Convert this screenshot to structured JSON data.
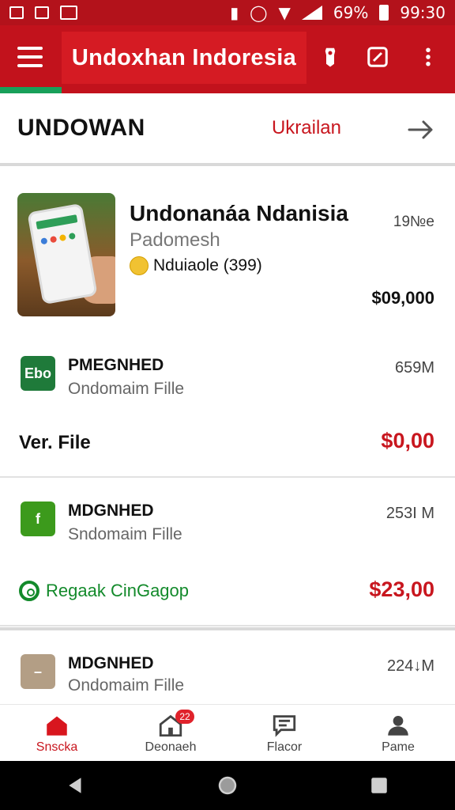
{
  "status_bar": {
    "battery": "69%",
    "time": "99:30"
  },
  "app_bar": {
    "title": "Undoxhan Indoresia"
  },
  "header": {
    "title": "UNDOWAN",
    "link": "Ukrailan"
  },
  "featured": {
    "title": "Undonanáa Ndanisia",
    "subtitle": "Padomesh",
    "rating": "Nduiaole (399)",
    "size": "19№e",
    "price": "$09,000"
  },
  "items": [
    {
      "icon_text": "Ebo",
      "icon_color": "#1f7a3a",
      "name": "PMEGNHED",
      "type": "Ondomaim Fille",
      "size": "659M",
      "left_label": "Ver. File",
      "price": "$0,00"
    },
    {
      "icon_text": "f",
      "icon_color": "#3c9a1c",
      "name": "MDGNHED",
      "type": "Sndomaim Fille",
      "size": "253I M",
      "left_label": "Regaak CinGagop",
      "price": "$23,00"
    },
    {
      "icon_text": "–",
      "icon_color": "#b39e85",
      "name": "MDGNHED",
      "type": "Ondomaim Fille",
      "size": "224↓M"
    }
  ],
  "bottom_nav": {
    "items": [
      {
        "label": "Snscka",
        "icon": "home-icon"
      },
      {
        "label": "Deonaeh",
        "icon": "home-outline-icon",
        "badge": "22"
      },
      {
        "label": "Flacor",
        "icon": "chat-icon"
      },
      {
        "label": "Pame",
        "icon": "profile-icon"
      }
    ]
  },
  "colors": {
    "primary": "#c2121c",
    "accent_green": "#18a05a",
    "price_red": "#c8161e"
  }
}
